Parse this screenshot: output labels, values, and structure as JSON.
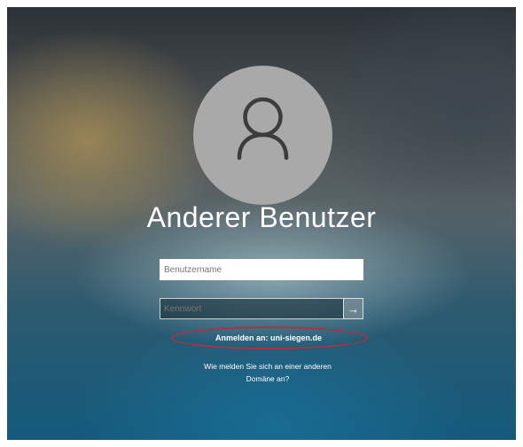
{
  "login": {
    "username": "Anderer Benutzer",
    "username_placeholder": "Benutzername",
    "password_placeholder": "Kennwort",
    "submit_icon": "→",
    "sign_in_link": "Anmelden an: uni-siegen.de",
    "other_domain_line1": "Wie melden Sie sich an einer anderen",
    "other_domain_line2": "Domäne an?"
  },
  "annotations": {
    "highlight_color": "#b03040"
  },
  "icons": {
    "avatar": "user-silhouette-icon",
    "submit": "arrow-right-icon"
  }
}
